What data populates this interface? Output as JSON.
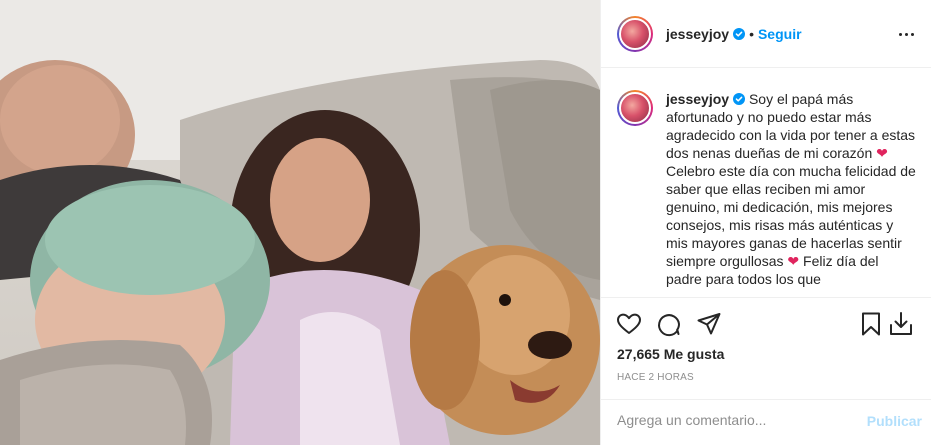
{
  "header": {
    "username": "jesseyjoy",
    "separator": "•",
    "follow_label": "Seguir"
  },
  "caption": {
    "username": "jesseyjoy",
    "text_parts": [
      "Soy el papá más afortunado y no puedo estar más agradecido con la vida por tener a estas dos nenas dueñas de mi corazón ",
      "❤",
      " Celebro este día con mucha felicidad de saber que ellas reciben mi amor genuino, mi dedicación, mis mejores consejos, mis risas más auténticas y mis mayores ganas de hacerlas sentir siempre orgullosas ",
      "❤",
      " Feliz día del padre para todos los que"
    ]
  },
  "stats": {
    "likes": "27,665 Me gusta",
    "time": "HACE 2 HORAS"
  },
  "comment": {
    "placeholder": "Agrega un comentario...",
    "publish_label": "Publicar"
  },
  "colors": {
    "accent": "#0095f6",
    "publish_disabled": "#b2dffc",
    "secondary_text": "#8e8e8e",
    "heart": "#e0245e"
  },
  "icons": [
    "heart-icon",
    "comment-icon",
    "share-icon",
    "save-icon",
    "download-icon",
    "more-options-icon",
    "verified-badge-icon"
  ]
}
